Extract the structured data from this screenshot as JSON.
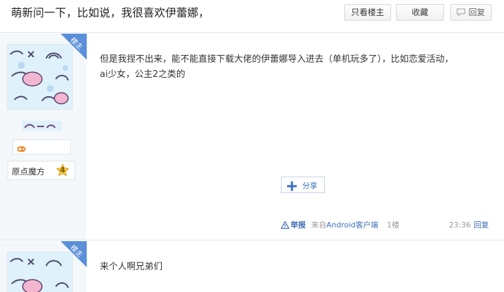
{
  "header": {
    "title": "萌新问一下，比如说，我很喜欢伊蕾娜，",
    "only_op_label": "只看楼主",
    "favorite_label": "收藏",
    "reply_label": "回复"
  },
  "posts": [
    {
      "badge": "楼主",
      "author_tag": "原点魔方",
      "author_level": "4",
      "content_lines": [
        "但是我捏不出来，能不能直接下载大佬的伊蕾娜导入进去（单机玩多了），比如恋爱活动，",
        "ai少女，公主2之类的"
      ],
      "share_label": "分享",
      "report_label": "举报",
      "source_prefix": "来自",
      "source_device": "Android客户端",
      "floor": "1楼",
      "time": "23:36",
      "reply_label": "回复"
    },
    {
      "badge": "楼主",
      "content_lines": [
        "来个人啊兄弟们"
      ]
    }
  ],
  "colors": {
    "badge": "#5b8fd9",
    "link": "#3e6db5",
    "author_bg": "#f5f8fb",
    "avatar_bg": "#dff1fb"
  },
  "icons": {
    "reply": "speech-bubble-icon",
    "report": "warning-triangle-icon",
    "share": "plus-icon",
    "game": "gamepad-icon",
    "level": "star-badge-icon"
  }
}
